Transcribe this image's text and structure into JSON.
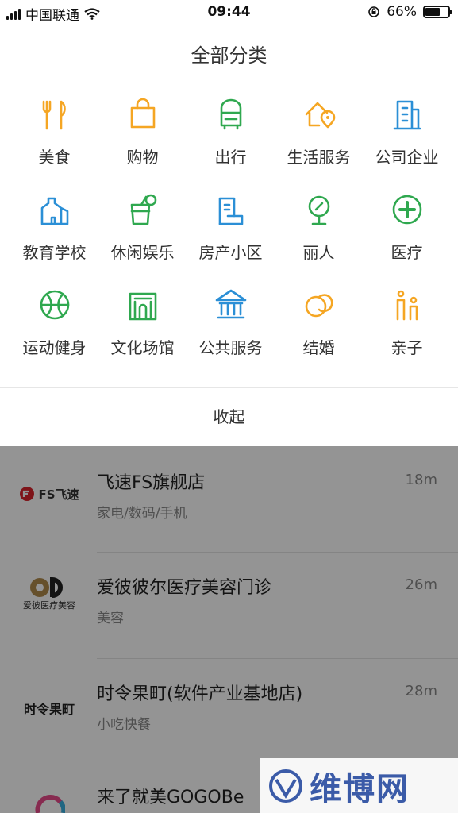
{
  "status_bar": {
    "carrier": "中国联通",
    "time": "09:44",
    "battery": "66%",
    "battery_level": 0.66
  },
  "panel": {
    "title": "全部分类",
    "categories": [
      {
        "label": "美食",
        "icon": "fork-knife-icon",
        "color": "#f5a623"
      },
      {
        "label": "购物",
        "icon": "shopping-bag-icon",
        "color": "#f5a623"
      },
      {
        "label": "出行",
        "icon": "bus-icon",
        "color": "#2fa84f"
      },
      {
        "label": "生活服务",
        "icon": "house-pin-icon",
        "color": "#f5a623"
      },
      {
        "label": "公司企业",
        "icon": "building-icon",
        "color": "#2b8fd6"
      },
      {
        "label": "教育学校",
        "icon": "school-icon",
        "color": "#2b8fd6"
      },
      {
        "label": "休闲娱乐",
        "icon": "drink-cup-icon",
        "color": "#2fa84f"
      },
      {
        "label": "房产小区",
        "icon": "real-estate-icon",
        "color": "#2b8fd6"
      },
      {
        "label": "丽人",
        "icon": "mirror-icon",
        "color": "#2fa84f"
      },
      {
        "label": "医疗",
        "icon": "medical-plus-icon",
        "color": "#2fa84f"
      },
      {
        "label": "运动健身",
        "icon": "sports-ball-icon",
        "color": "#2fa84f"
      },
      {
        "label": "文化场馆",
        "icon": "venue-icon",
        "color": "#2fa84f"
      },
      {
        "label": "公共服务",
        "icon": "public-building-icon",
        "color": "#2b8fd6"
      },
      {
        "label": "结婚",
        "icon": "rings-icon",
        "color": "#f5a623"
      },
      {
        "label": "亲子",
        "icon": "parent-child-icon",
        "color": "#f5a623"
      }
    ],
    "collapse_label": "收起"
  },
  "list": {
    "items": [
      {
        "name": "飞速FS旗舰店",
        "category": "家电/数码/手机",
        "distance": "18m",
        "logo_text": "FS飞速"
      },
      {
        "name": "爱彼彼尔医疗美容门诊",
        "category": "美容",
        "distance": "26m",
        "logo_text": "爱彼医疗美容"
      },
      {
        "name": "时令果町(软件产业基地店)",
        "category": "小吃快餐",
        "distance": "28m",
        "logo_text": "时令果町"
      },
      {
        "name": "来了就美GOGOBe",
        "category": "",
        "distance": "",
        "logo_text": ""
      }
    ]
  },
  "watermark": {
    "text": "维博网"
  }
}
